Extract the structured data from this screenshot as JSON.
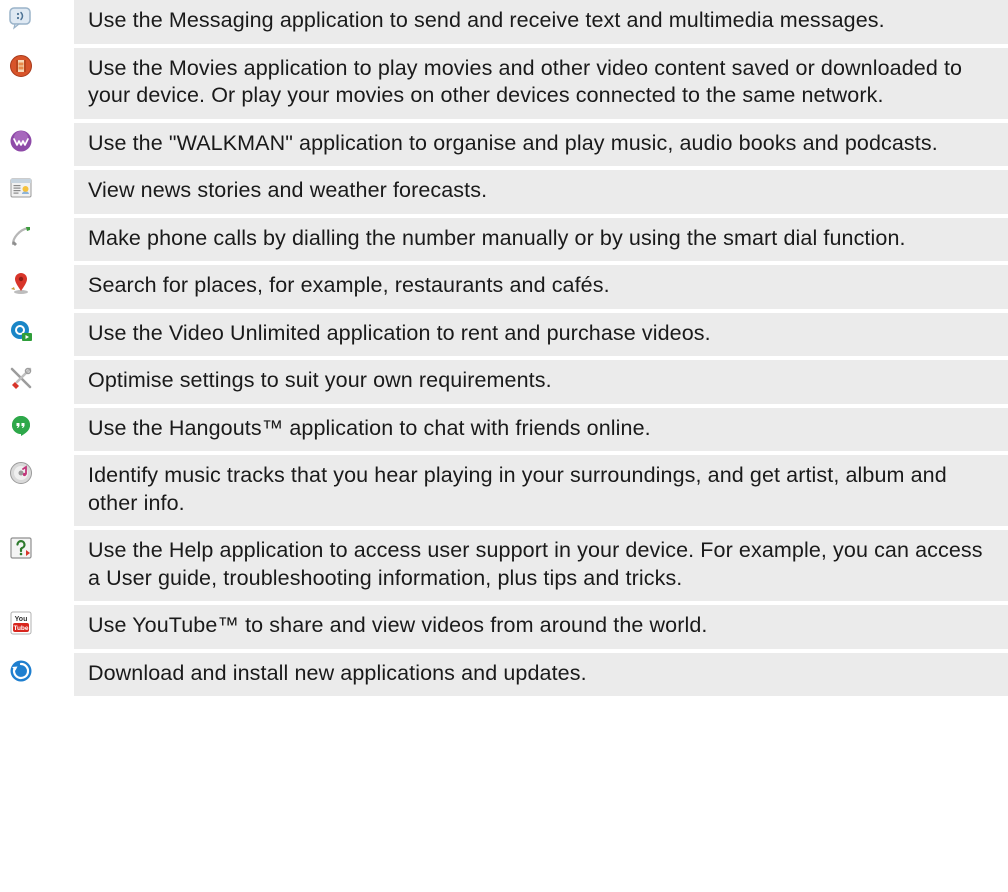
{
  "rows": [
    {
      "icon": "messaging-icon",
      "text": "Use the Messaging application to send and receive text and multimedia messages."
    },
    {
      "icon": "movies-icon",
      "text": "Use the Movies application to play movies and other video content saved or downloaded to your device. Or play your movies on other devices connected to the same network."
    },
    {
      "icon": "walkman-icon",
      "text": "Use the \"WALKMAN\" application to organise and play music, audio books and podcasts."
    },
    {
      "icon": "news-weather-icon",
      "text": "View news stories and weather forecasts."
    },
    {
      "icon": "phone-icon",
      "text": "Make phone calls by dialling the number manually or by using the smart dial function."
    },
    {
      "icon": "local-places-icon",
      "text": "Search for places, for example, restaurants and cafés."
    },
    {
      "icon": "video-unlimited-icon",
      "text": "Use the Video Unlimited application to rent and purchase videos."
    },
    {
      "icon": "settings-icon",
      "text": "Optimise settings to suit your own requirements."
    },
    {
      "icon": "hangouts-icon",
      "text": "Use the Hangouts™ application to chat with friends online."
    },
    {
      "icon": "trackid-icon",
      "text": "Identify music tracks that you hear playing in your surroundings, and get artist, album and other info."
    },
    {
      "icon": "help-icon",
      "text": "Use the Help application to access user support in your device. For example, you can access a User guide, troubleshooting information, plus tips and tricks."
    },
    {
      "icon": "youtube-icon",
      "text": "Use YouTube™ to share and view videos from around the world."
    },
    {
      "icon": "update-center-icon",
      "text": "Download and install new applications and updates."
    }
  ]
}
